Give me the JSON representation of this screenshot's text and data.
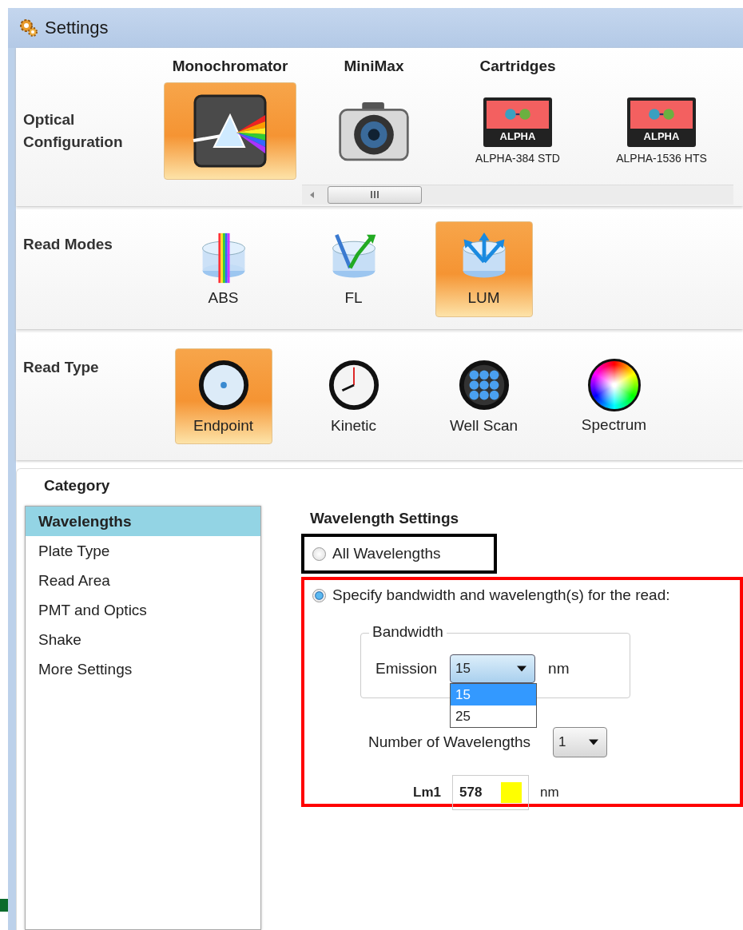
{
  "window": {
    "title": "Settings"
  },
  "optical": {
    "label": "Optical Configuration",
    "items": [
      {
        "header": "Monochromator",
        "kind": "prism",
        "selected": true
      },
      {
        "header": "MiniMax",
        "kind": "camera",
        "selected": false
      },
      {
        "header": "Cartridges",
        "kind": "cartridge",
        "badge": "ALPHA",
        "caption": "ALPHA-384 STD",
        "selected": false
      },
      {
        "kind": "cartridge",
        "badge": "ALPHA",
        "caption": "ALPHA-1536 HTS",
        "selected": false
      }
    ]
  },
  "read_modes": {
    "label": "Read Modes",
    "items": [
      {
        "kind": "abs",
        "caption": "ABS",
        "selected": false
      },
      {
        "kind": "fl",
        "caption": "FL",
        "selected": false
      },
      {
        "kind": "lum",
        "caption": "LUM",
        "selected": true
      }
    ]
  },
  "read_type": {
    "label": "Read Type",
    "items": [
      {
        "kind": "endpoint",
        "caption": "Endpoint",
        "selected": true
      },
      {
        "kind": "clock",
        "caption": "Kinetic",
        "selected": false
      },
      {
        "kind": "wells",
        "caption": "Well Scan",
        "selected": false
      },
      {
        "kind": "spectrum",
        "caption": "Spectrum",
        "selected": false
      }
    ]
  },
  "category": {
    "title": "Category",
    "items": [
      {
        "label": "Wavelengths",
        "selected": true
      },
      {
        "label": "Plate Type",
        "selected": false
      },
      {
        "label": "Read Area",
        "selected": false
      },
      {
        "label": "PMT and Optics",
        "selected": false
      },
      {
        "label": "Shake",
        "selected": false
      },
      {
        "label": "More Settings",
        "selected": false
      }
    ]
  },
  "wavelength_settings": {
    "title": "Wavelength Settings",
    "options": [
      {
        "label": "All Wavelengths",
        "selected": false
      },
      {
        "label": "Specify bandwidth and wavelength(s) for the read:",
        "selected": true
      }
    ],
    "bandwidth": {
      "legend": "Bandwidth",
      "label": "Emission",
      "value": "15",
      "unit": "nm",
      "options": [
        {
          "label": "15",
          "selected": true
        },
        {
          "label": "25",
          "selected": false
        }
      ]
    },
    "count": {
      "label": "Number of Wavelengths",
      "value": "1"
    },
    "wavelengths": [
      {
        "label": "Lm1",
        "value": "578",
        "color": "#ffff00",
        "unit": "nm"
      }
    ]
  }
}
